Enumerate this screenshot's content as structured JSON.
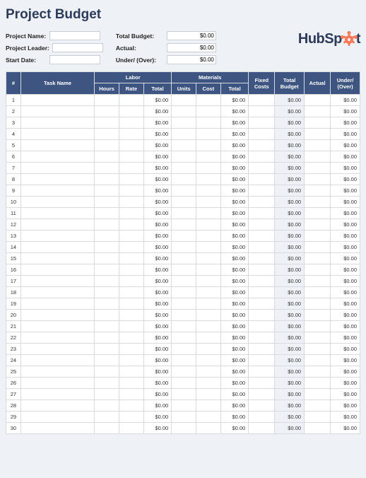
{
  "title": "Project Budget",
  "brand": {
    "prefix": "HubSp",
    "suffix": "t"
  },
  "fields": {
    "projectName": {
      "label": "Project Name:",
      "value": ""
    },
    "projectLeader": {
      "label": "Project Leader:",
      "value": ""
    },
    "startDate": {
      "label": "Start Date:",
      "value": ""
    },
    "totalBudget": {
      "label": "Total Budget:",
      "value": "$0.00"
    },
    "actual": {
      "label": "Actual:",
      "value": "$0.00"
    },
    "underOver": {
      "label": "Under/ (Over):",
      "value": "$0.00"
    }
  },
  "columns": {
    "idx": "#",
    "task": "Task Name",
    "laborGroup": "Labor",
    "hours": "Hours",
    "rate": "Rate",
    "laborTotal": "Total",
    "materialsGroup": "Materials",
    "units": "Units",
    "cost": "Cost",
    "matTotal": "Total",
    "fixed": "Fixed Costs",
    "totalBudget": "Total Budget",
    "actual": "Actual",
    "underOver": "Under/ (Over)"
  },
  "rows": [
    {
      "idx": 1,
      "task": "",
      "hours": "",
      "rate": "",
      "laborTotal": "$0.00",
      "units": "",
      "cost": "",
      "matTotal": "$0.00",
      "fixed": "",
      "totalBudget": "$0.00",
      "actual": "",
      "underOver": "$0.00"
    },
    {
      "idx": 2,
      "task": "",
      "hours": "",
      "rate": "",
      "laborTotal": "$0.00",
      "units": "",
      "cost": "",
      "matTotal": "$0.00",
      "fixed": "",
      "totalBudget": "$0.00",
      "actual": "",
      "underOver": "$0.00"
    },
    {
      "idx": 3,
      "task": "",
      "hours": "",
      "rate": "",
      "laborTotal": "$0.00",
      "units": "",
      "cost": "",
      "matTotal": "$0.00",
      "fixed": "",
      "totalBudget": "$0.00",
      "actual": "",
      "underOver": "$0.00"
    },
    {
      "idx": 4,
      "task": "",
      "hours": "",
      "rate": "",
      "laborTotal": "$0.00",
      "units": "",
      "cost": "",
      "matTotal": "$0.00",
      "fixed": "",
      "totalBudget": "$0.00",
      "actual": "",
      "underOver": "$0.00"
    },
    {
      "idx": 5,
      "task": "",
      "hours": "",
      "rate": "",
      "laborTotal": "$0.00",
      "units": "",
      "cost": "",
      "matTotal": "$0.00",
      "fixed": "",
      "totalBudget": "$0.00",
      "actual": "",
      "underOver": "$0.00"
    },
    {
      "idx": 6,
      "task": "",
      "hours": "",
      "rate": "",
      "laborTotal": "$0.00",
      "units": "",
      "cost": "",
      "matTotal": "$0.00",
      "fixed": "",
      "totalBudget": "$0.00",
      "actual": "",
      "underOver": "$0.00"
    },
    {
      "idx": 7,
      "task": "",
      "hours": "",
      "rate": "",
      "laborTotal": "$0.00",
      "units": "",
      "cost": "",
      "matTotal": "$0.00",
      "fixed": "",
      "totalBudget": "$0.00",
      "actual": "",
      "underOver": "$0.00"
    },
    {
      "idx": 8,
      "task": "",
      "hours": "",
      "rate": "",
      "laborTotal": "$0.00",
      "units": "",
      "cost": "",
      "matTotal": "$0.00",
      "fixed": "",
      "totalBudget": "$0.00",
      "actual": "",
      "underOver": "$0.00"
    },
    {
      "idx": 9,
      "task": "",
      "hours": "",
      "rate": "",
      "laborTotal": "$0.00",
      "units": "",
      "cost": "",
      "matTotal": "$0.00",
      "fixed": "",
      "totalBudget": "$0.00",
      "actual": "",
      "underOver": "$0.00"
    },
    {
      "idx": 10,
      "task": "",
      "hours": "",
      "rate": "",
      "laborTotal": "$0.00",
      "units": "",
      "cost": "",
      "matTotal": "$0.00",
      "fixed": "",
      "totalBudget": "$0.00",
      "actual": "",
      "underOver": "$0.00"
    },
    {
      "idx": 11,
      "task": "",
      "hours": "",
      "rate": "",
      "laborTotal": "$0.00",
      "units": "",
      "cost": "",
      "matTotal": "$0.00",
      "fixed": "",
      "totalBudget": "$0.00",
      "actual": "",
      "underOver": "$0.00"
    },
    {
      "idx": 12,
      "task": "",
      "hours": "",
      "rate": "",
      "laborTotal": "$0.00",
      "units": "",
      "cost": "",
      "matTotal": "$0.00",
      "fixed": "",
      "totalBudget": "$0.00",
      "actual": "",
      "underOver": "$0.00"
    },
    {
      "idx": 13,
      "task": "",
      "hours": "",
      "rate": "",
      "laborTotal": "$0.00",
      "units": "",
      "cost": "",
      "matTotal": "$0.00",
      "fixed": "",
      "totalBudget": "$0.00",
      "actual": "",
      "underOver": "$0.00"
    },
    {
      "idx": 14,
      "task": "",
      "hours": "",
      "rate": "",
      "laborTotal": "$0.00",
      "units": "",
      "cost": "",
      "matTotal": "$0.00",
      "fixed": "",
      "totalBudget": "$0.00",
      "actual": "",
      "underOver": "$0.00"
    },
    {
      "idx": 15,
      "task": "",
      "hours": "",
      "rate": "",
      "laborTotal": "$0.00",
      "units": "",
      "cost": "",
      "matTotal": "$0.00",
      "fixed": "",
      "totalBudget": "$0.00",
      "actual": "",
      "underOver": "$0.00"
    },
    {
      "idx": 16,
      "task": "",
      "hours": "",
      "rate": "",
      "laborTotal": "$0.00",
      "units": "",
      "cost": "",
      "matTotal": "$0.00",
      "fixed": "",
      "totalBudget": "$0.00",
      "actual": "",
      "underOver": "$0.00"
    },
    {
      "idx": 17,
      "task": "",
      "hours": "",
      "rate": "",
      "laborTotal": "$0.00",
      "units": "",
      "cost": "",
      "matTotal": "$0.00",
      "fixed": "",
      "totalBudget": "$0.00",
      "actual": "",
      "underOver": "$0.00"
    },
    {
      "idx": 18,
      "task": "",
      "hours": "",
      "rate": "",
      "laborTotal": "$0.00",
      "units": "",
      "cost": "",
      "matTotal": "$0.00",
      "fixed": "",
      "totalBudget": "$0.00",
      "actual": "",
      "underOver": "$0.00"
    },
    {
      "idx": 19,
      "task": "",
      "hours": "",
      "rate": "",
      "laborTotal": "$0.00",
      "units": "",
      "cost": "",
      "matTotal": "$0.00",
      "fixed": "",
      "totalBudget": "$0.00",
      "actual": "",
      "underOver": "$0.00"
    },
    {
      "idx": 20,
      "task": "",
      "hours": "",
      "rate": "",
      "laborTotal": "$0.00",
      "units": "",
      "cost": "",
      "matTotal": "$0.00",
      "fixed": "",
      "totalBudget": "$0.00",
      "actual": "",
      "underOver": "$0.00"
    },
    {
      "idx": 21,
      "task": "",
      "hours": "",
      "rate": "",
      "laborTotal": "$0.00",
      "units": "",
      "cost": "",
      "matTotal": "$0.00",
      "fixed": "",
      "totalBudget": "$0.00",
      "actual": "",
      "underOver": "$0.00"
    },
    {
      "idx": 22,
      "task": "",
      "hours": "",
      "rate": "",
      "laborTotal": "$0.00",
      "units": "",
      "cost": "",
      "matTotal": "$0.00",
      "fixed": "",
      "totalBudget": "$0.00",
      "actual": "",
      "underOver": "$0.00"
    },
    {
      "idx": 23,
      "task": "",
      "hours": "",
      "rate": "",
      "laborTotal": "$0.00",
      "units": "",
      "cost": "",
      "matTotal": "$0.00",
      "fixed": "",
      "totalBudget": "$0.00",
      "actual": "",
      "underOver": "$0.00"
    },
    {
      "idx": 24,
      "task": "",
      "hours": "",
      "rate": "",
      "laborTotal": "$0.00",
      "units": "",
      "cost": "",
      "matTotal": "$0.00",
      "fixed": "",
      "totalBudget": "$0.00",
      "actual": "",
      "underOver": "$0.00"
    },
    {
      "idx": 25,
      "task": "",
      "hours": "",
      "rate": "",
      "laborTotal": "$0.00",
      "units": "",
      "cost": "",
      "matTotal": "$0.00",
      "fixed": "",
      "totalBudget": "$0.00",
      "actual": "",
      "underOver": "$0.00"
    },
    {
      "idx": 26,
      "task": "",
      "hours": "",
      "rate": "",
      "laborTotal": "$0.00",
      "units": "",
      "cost": "",
      "matTotal": "$0.00",
      "fixed": "",
      "totalBudget": "$0.00",
      "actual": "",
      "underOver": "$0.00"
    },
    {
      "idx": 27,
      "task": "",
      "hours": "",
      "rate": "",
      "laborTotal": "$0.00",
      "units": "",
      "cost": "",
      "matTotal": "$0.00",
      "fixed": "",
      "totalBudget": "$0.00",
      "actual": "",
      "underOver": "$0.00"
    },
    {
      "idx": 28,
      "task": "",
      "hours": "",
      "rate": "",
      "laborTotal": "$0.00",
      "units": "",
      "cost": "",
      "matTotal": "$0.00",
      "fixed": "",
      "totalBudget": "$0.00",
      "actual": "",
      "underOver": "$0.00"
    },
    {
      "idx": 29,
      "task": "",
      "hours": "",
      "rate": "",
      "laborTotal": "$0.00",
      "units": "",
      "cost": "",
      "matTotal": "$0.00",
      "fixed": "",
      "totalBudget": "$0.00",
      "actual": "",
      "underOver": "$0.00"
    },
    {
      "idx": 30,
      "task": "",
      "hours": "",
      "rate": "",
      "laborTotal": "$0.00",
      "units": "",
      "cost": "",
      "matTotal": "$0.00",
      "fixed": "",
      "totalBudget": "$0.00",
      "actual": "",
      "underOver": "$0.00"
    }
  ]
}
